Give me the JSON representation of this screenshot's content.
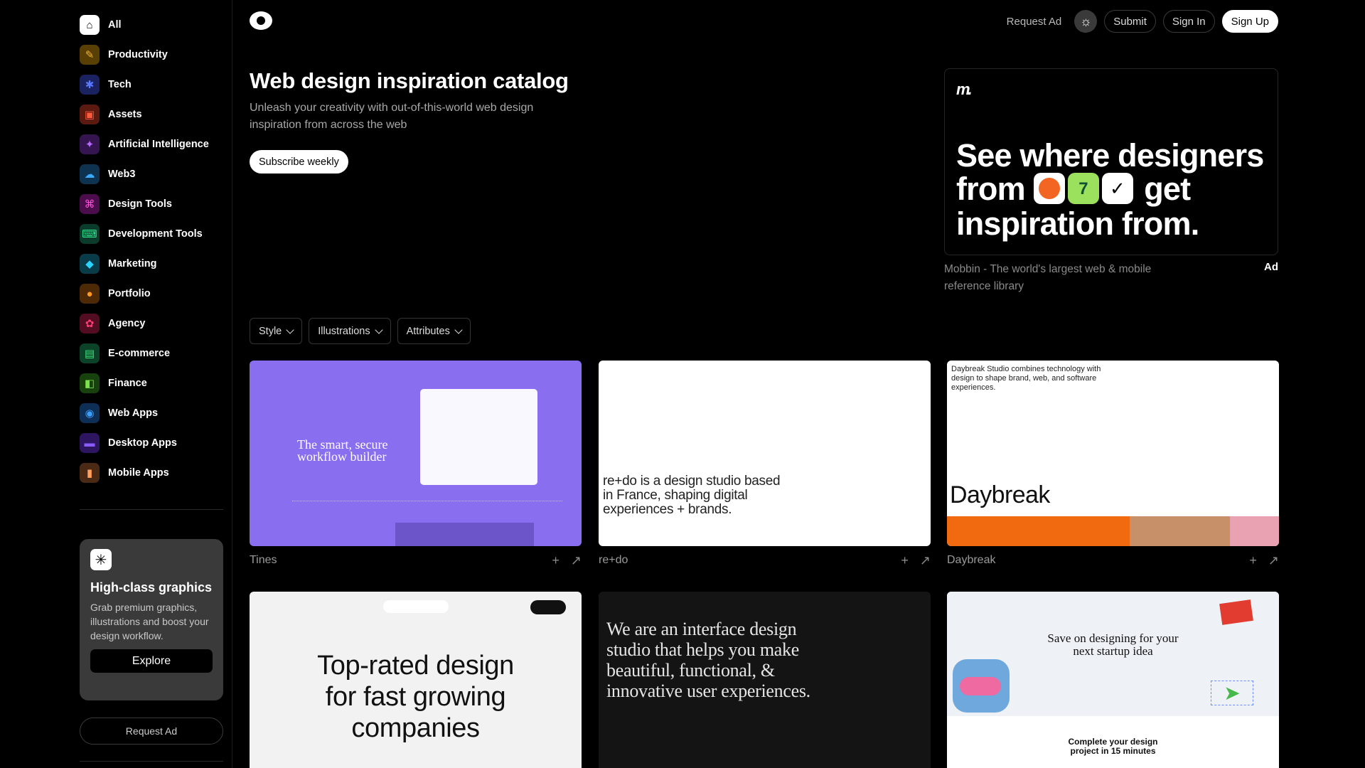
{
  "sidebar": {
    "items": [
      {
        "label": "All",
        "icon": "home-icon",
        "glyph": "⌂",
        "bg": "#ffffff",
        "fg": "#000000"
      },
      {
        "label": "Productivity",
        "icon": "productivity-icon",
        "glyph": "✎",
        "bg": "#5a3f05",
        "fg": "#f0b429"
      },
      {
        "label": "Tech",
        "icon": "chip-icon",
        "glyph": "✱",
        "bg": "#1a2260",
        "fg": "#5a78ff"
      },
      {
        "label": "Assets",
        "icon": "box-icon",
        "glyph": "▣",
        "bg": "#5a1a10",
        "fg": "#ff5a3c"
      },
      {
        "label": "Artificial Intelligence",
        "icon": "sparkle-icon",
        "glyph": "✦",
        "bg": "#34154f",
        "fg": "#b768ff"
      },
      {
        "label": "Web3",
        "icon": "cloud-icon",
        "glyph": "☁",
        "bg": "#0d3350",
        "fg": "#3ca9ff"
      },
      {
        "label": "Design Tools",
        "icon": "vector-icon",
        "glyph": "⌘",
        "bg": "#4b0d4b",
        "fg": "#ff4fd8"
      },
      {
        "label": "Development Tools",
        "icon": "code-icon",
        "glyph": "⌨",
        "bg": "#0b3b2a",
        "fg": "#2ee08a"
      },
      {
        "label": "Marketing",
        "icon": "tag-icon",
        "glyph": "◆",
        "bg": "#0a3b48",
        "fg": "#2ad4ff"
      },
      {
        "label": "Portfolio",
        "icon": "person-icon",
        "glyph": "●",
        "bg": "#4d2a05",
        "fg": "#ff9a1f"
      },
      {
        "label": "Agency",
        "icon": "group-icon",
        "glyph": "✿",
        "bg": "#520d22",
        "fg": "#ff3b73"
      },
      {
        "label": "E-commerce",
        "icon": "shopping-bag-icon",
        "glyph": "▤",
        "bg": "#0b4228",
        "fg": "#3de27a"
      },
      {
        "label": "Finance",
        "icon": "wallet-icon",
        "glyph": "◧",
        "bg": "#18420d",
        "fg": "#7ce04a"
      },
      {
        "label": "Web Apps",
        "icon": "compass-icon",
        "glyph": "◉",
        "bg": "#0d2f55",
        "fg": "#3aa0ff"
      },
      {
        "label": "Desktop Apps",
        "icon": "monitor-icon",
        "glyph": "▬",
        "bg": "#2e1560",
        "fg": "#8a5cff"
      },
      {
        "label": "Mobile Apps",
        "icon": "phone-icon",
        "glyph": "▮",
        "bg": "#4a2a14",
        "fg": "#ffa060"
      }
    ],
    "promo": {
      "title": "High-class graphics",
      "text": "Grab premium graphics, illustrations and boost your design workflow.",
      "button": "Explore"
    },
    "request_ad": "Request Ad"
  },
  "topbar": {
    "request_ad": "Request Ad",
    "submit": "Submit",
    "sign_in": "Sign In",
    "sign_up": "Sign Up"
  },
  "hero": {
    "title": "Web design inspiration catalog",
    "subtitle": "Unleash your creativity with out-of-this-world web design inspiration from across the web",
    "subscribe": "Subscribe weekly"
  },
  "ad": {
    "headline_1": "See where designers",
    "headline_2a": "from",
    "headline_2b": "get",
    "headline_3": "inspiration from.",
    "caption": "Mobbin - The world's largest web & mobile reference library",
    "tag": "Ad"
  },
  "filters": [
    "Style",
    "Illustrations",
    "Attributes"
  ],
  "cards": [
    {
      "name": "Tines",
      "thumb_text": "The smart, secure workflow builder"
    },
    {
      "name": "re+do",
      "thumb_text": "re+do is a design studio based in France, shaping digital experiences + brands."
    },
    {
      "name": "Daybreak",
      "thumb_text": "Daybreak Studio combines technology with design to shape brand, web, and software experiences.",
      "thumb_word": "Daybreak"
    },
    {
      "name": "",
      "thumb_text": "Top-rated design for fast growing companies"
    },
    {
      "name": "",
      "thumb_text": "We are an interface design studio that helps you make beautiful, functional, & innovative user experiences."
    },
    {
      "name": "",
      "thumb_text": "Save on designing for your next startup idea",
      "thumb_text_2": "Complete your design project in 15 minutes"
    }
  ]
}
